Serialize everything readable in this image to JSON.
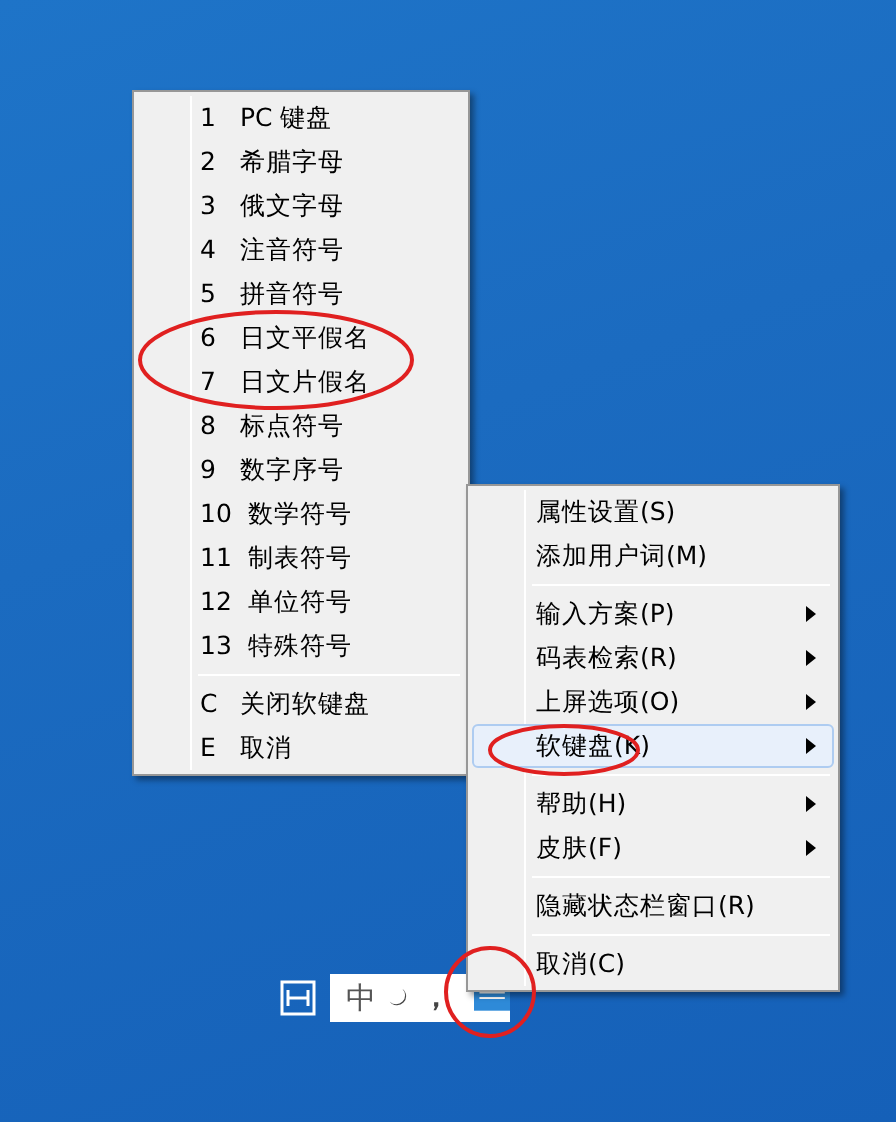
{
  "soft_keyboard_menu": {
    "items": [
      {
        "kind": "item",
        "key": "1",
        "label": "PC 键盘"
      },
      {
        "kind": "item",
        "key": "2",
        "label": "希腊字母"
      },
      {
        "kind": "item",
        "key": "3",
        "label": "俄文字母"
      },
      {
        "kind": "item",
        "key": "4",
        "label": "注音符号"
      },
      {
        "kind": "item",
        "key": "5",
        "label": "拼音符号"
      },
      {
        "kind": "item",
        "key": "6",
        "label": "日文平假名"
      },
      {
        "kind": "item",
        "key": "7",
        "label": "日文片假名"
      },
      {
        "kind": "item",
        "key": "8",
        "label": "标点符号"
      },
      {
        "kind": "item",
        "key": "9",
        "label": "数字序号"
      },
      {
        "kind": "item",
        "key": "10",
        "label": "数学符号"
      },
      {
        "kind": "item",
        "key": "11",
        "label": "制表符号"
      },
      {
        "kind": "item",
        "key": "12",
        "label": "单位符号"
      },
      {
        "kind": "item",
        "key": "13",
        "label": "特殊符号"
      },
      {
        "kind": "separator"
      },
      {
        "kind": "item",
        "key": "C",
        "label": "关闭软键盘"
      },
      {
        "kind": "item",
        "key": "E",
        "label": "取消"
      }
    ]
  },
  "context_menu": {
    "items": [
      {
        "kind": "item",
        "label": "属性设置(S)",
        "submenu": false,
        "selected": false
      },
      {
        "kind": "item",
        "label": "添加用户词(M)",
        "submenu": false,
        "selected": false
      },
      {
        "kind": "separator"
      },
      {
        "kind": "item",
        "label": "输入方案(P)",
        "submenu": true,
        "selected": false
      },
      {
        "kind": "item",
        "label": "码表检索(R)",
        "submenu": true,
        "selected": false
      },
      {
        "kind": "item",
        "label": "上屏选项(O)",
        "submenu": true,
        "selected": false
      },
      {
        "kind": "item",
        "label": "软键盘(K)",
        "submenu": true,
        "selected": true
      },
      {
        "kind": "separator"
      },
      {
        "kind": "item",
        "label": "帮助(H)",
        "submenu": true,
        "selected": false
      },
      {
        "kind": "item",
        "label": "皮肤(F)",
        "submenu": true,
        "selected": false
      },
      {
        "kind": "separator"
      },
      {
        "kind": "item",
        "label": "隐藏状态栏窗口(R)",
        "submenu": false,
        "selected": false
      },
      {
        "kind": "separator"
      },
      {
        "kind": "item",
        "label": "取消(C)",
        "submenu": false,
        "selected": false
      }
    ]
  },
  "status_bar": {
    "mode": "中",
    "punctuation": "，"
  }
}
